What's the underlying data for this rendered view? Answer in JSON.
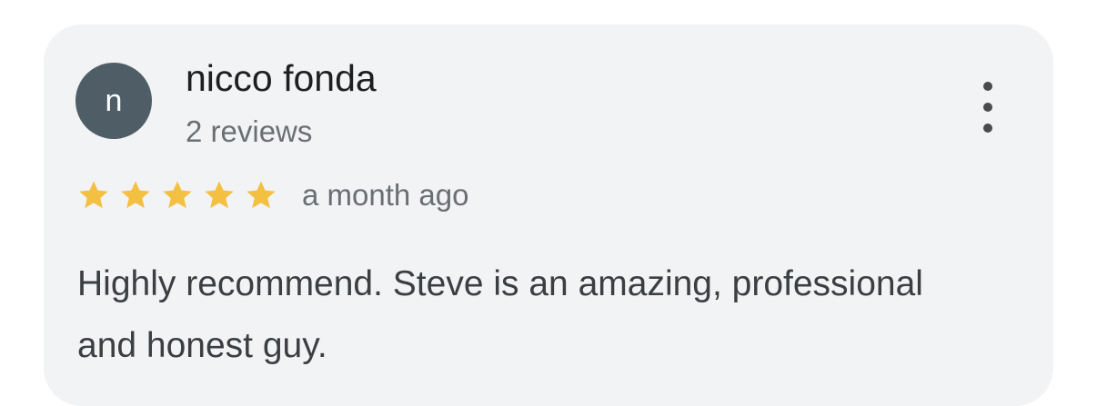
{
  "review": {
    "author_initial": "n",
    "author_name": "nicco fonda",
    "author_reviews": "2 reviews",
    "rating": 5,
    "rating_max": 5,
    "star_color": "#f4c041",
    "date": "a month ago",
    "text": "Highly recommend. Steve is an amazing, professional and honest guy."
  },
  "icons": {
    "menu": "more-vertical-icon",
    "star": "star-icon"
  },
  "colors": {
    "card_background": "#f2f3f5",
    "avatar_background": "#4f5d66"
  }
}
